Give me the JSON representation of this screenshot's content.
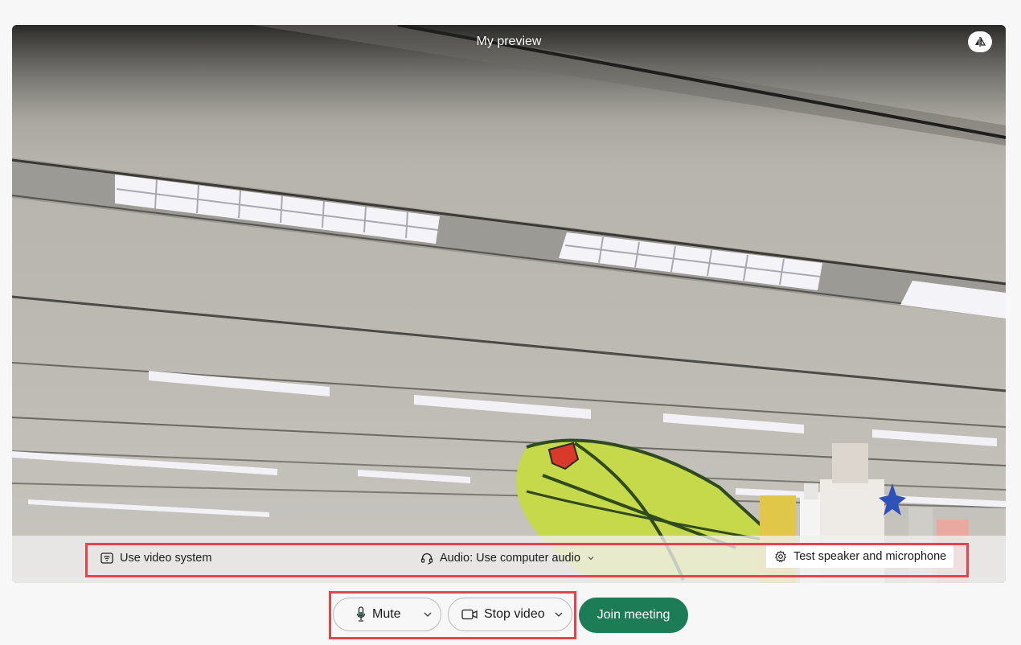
{
  "preview": {
    "title": "My preview",
    "mirror_icon": "mirror-flip-icon"
  },
  "options": {
    "video_system_label": "Use video system",
    "video_system_icon": "video-system-icon",
    "audio_label": "Audio: Use computer audio",
    "audio_icon": "headset-icon",
    "test_label": "Test speaker and microphone",
    "test_icon": "gear-icon"
  },
  "controls": {
    "mute_label": "Mute",
    "mute_icon": "microphone-icon",
    "stop_video_label": "Stop video",
    "stop_video_icon": "camera-icon",
    "join_label": "Join meeting"
  },
  "colors": {
    "join_green": "#1c7c56",
    "highlight_red": "#e0474c"
  }
}
